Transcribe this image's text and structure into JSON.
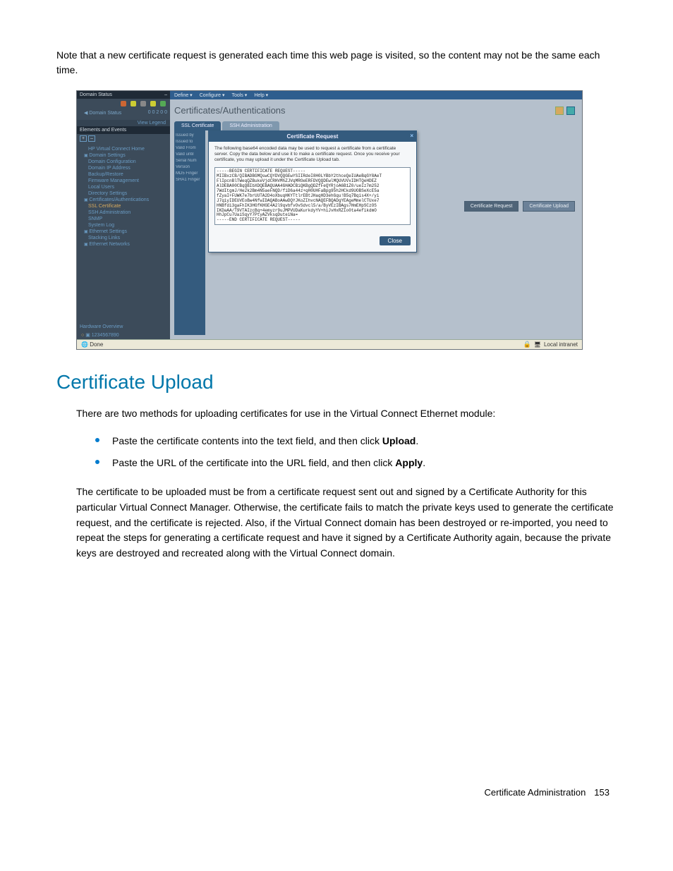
{
  "intro": "Note that a new certificate request is generated each time this web page is visited, so the content may not be the same each time.",
  "shot": {
    "sidebar_head": "Domain Status",
    "domain_status_label": "Domain Status",
    "domain_status_nums": "0  0  2  0  0",
    "view_legend": "View Legend",
    "sec_elements": "Elements and Events",
    "nav": [
      {
        "label": "HP Virtual Connect Home",
        "lvl": 1,
        "hl": false,
        "ic": false
      },
      {
        "label": "Domain Settings",
        "lvl": 0,
        "hl": false,
        "ic": true
      },
      {
        "label": "Domain Configuration",
        "lvl": 1,
        "hl": false,
        "ic": false
      },
      {
        "label": "Domain IP Address",
        "lvl": 1,
        "hl": false,
        "ic": false
      },
      {
        "label": "Backup/Restore",
        "lvl": 1,
        "hl": false,
        "ic": false
      },
      {
        "label": "Firmware Management",
        "lvl": 1,
        "hl": false,
        "ic": false
      },
      {
        "label": "Local Users",
        "lvl": 1,
        "hl": false,
        "ic": false
      },
      {
        "label": "Directory Settings",
        "lvl": 1,
        "hl": false,
        "ic": false
      },
      {
        "label": "Certificates/Authentications",
        "lvl": 0,
        "hl": false,
        "ic": true
      },
      {
        "label": "SSL Certificate",
        "lvl": 1,
        "hl": true,
        "ic": false
      },
      {
        "label": "SSH Administration",
        "lvl": 1,
        "hl": false,
        "ic": false
      },
      {
        "label": "SNMP",
        "lvl": 1,
        "hl": false,
        "ic": false
      },
      {
        "label": "System Log",
        "lvl": 1,
        "hl": false,
        "ic": false
      },
      {
        "label": "Ethernet Settings",
        "lvl": 0,
        "hl": false,
        "ic": true
      },
      {
        "label": "Stacking Links",
        "lvl": 1,
        "hl": false,
        "ic": false
      },
      {
        "label": "Ethernet Networks",
        "lvl": 0,
        "hl": false,
        "ic": true
      }
    ],
    "hardware_overview": "Hardware Overview",
    "rack_item": "1234567890",
    "menubar": [
      "Define ▾",
      "Configure ▾",
      "Tools ▾",
      "Help ▾"
    ],
    "page_title": "Certificates/Authentications",
    "tabs": [
      "SSL Certificate",
      "SSH Administration"
    ],
    "active_tab": 0,
    "infocol": [
      "Issued by",
      "Issued to",
      "Valid From",
      "Valid until",
      "Serial Num",
      "Version",
      "MD5 Finger",
      "SHA1 Finger"
    ],
    "modal": {
      "title": "Certificate Request",
      "desc": "The following base64 encoded data may be used to request a certificate from a certificate server. Copy the data below and use it to make a certificate request. Once you receive your certificate, you may upload it under the Certificate Upload tab.",
      "csr": "-----BEGIN CERTIFICATE REQUEST-----\nMIIBxzCB/QIBADBGMQswCQYDVQQGEwYSIIRdeI8H0LYBbY2thceQeIUAeBqGY8AeT\nFlIpcnBlTWeqQZBukeVjdCRHVMhZJVqMROeERFDVQQDEwlMQUVUVxIDHTQeHDEZ\nAlDEBA00CBqQBIbXDQEBAQUAA4GHADCBiQKBgQDZfFeQYRjoA6B1Z0/ueIz7m252\n7WdItgmJ/He2k2Bm4N5aeFNQD/fiD6a44z+qH0UHFaBpg95h2HCkd9UOBSeXcE5a\nfZyaI+FUWK7e7brUUTA2D4oXbuqHKYTtlrEBtJHaqHD3ehGqu!B5q7Bqis4X+/yi\nJ7qiyIDEUVEoBw4NfwIDAQABoAAwDQYJKoZIhvcNAQEFBQADgYEAgeMmelCTUxe7\nHNBfdi3gaFhIK3HGfKHGE4A2l9qvbfvOvSdvcl5/a/ByVEzIBAgs7HmEHpSCzOS\nIKDaAA/T9VTAIzcBq+4emyzr9uJMPVUDaKurkdyYV+hiJvHxRZIo0ta4efikdmO\nHhJpCu7UaiSqyY7PtyAZVksqDuteiNa=\n-----END CERTIFICATE REQUEST-----",
      "close": "Close"
    },
    "right_buttons": [
      "Certificate Request",
      "Certificate Upload"
    ],
    "statusbar_left": "Done",
    "statusbar_right": "Local intranet"
  },
  "h1": "Certificate Upload",
  "p1": "There are two methods for uploading certificates for use in the Virtual Connect Ethernet module:",
  "bullets": [
    {
      "pre": "Paste the certificate contents into the text field, and then click ",
      "bold": "Upload",
      "post": "."
    },
    {
      "pre": "Paste the URL of the certificate into the URL field, and then click ",
      "bold": "Apply",
      "post": "."
    }
  ],
  "p2": "The certificate to be uploaded must be from a certificate request sent out and signed by a Certificate Authority for this particular Virtual Connect Manager. Otherwise, the certificate fails to match the private keys used to generate the certificate request, and the certificate is rejected. Also, if the Virtual Connect domain has been destroyed or re-imported, you need to repeat the steps for generating a certificate request and have it signed by a Certificate Authority again, because the private keys are destroyed and recreated along with the Virtual Connect domain.",
  "footer_label": "Certificate Administration",
  "footer_page": "153"
}
